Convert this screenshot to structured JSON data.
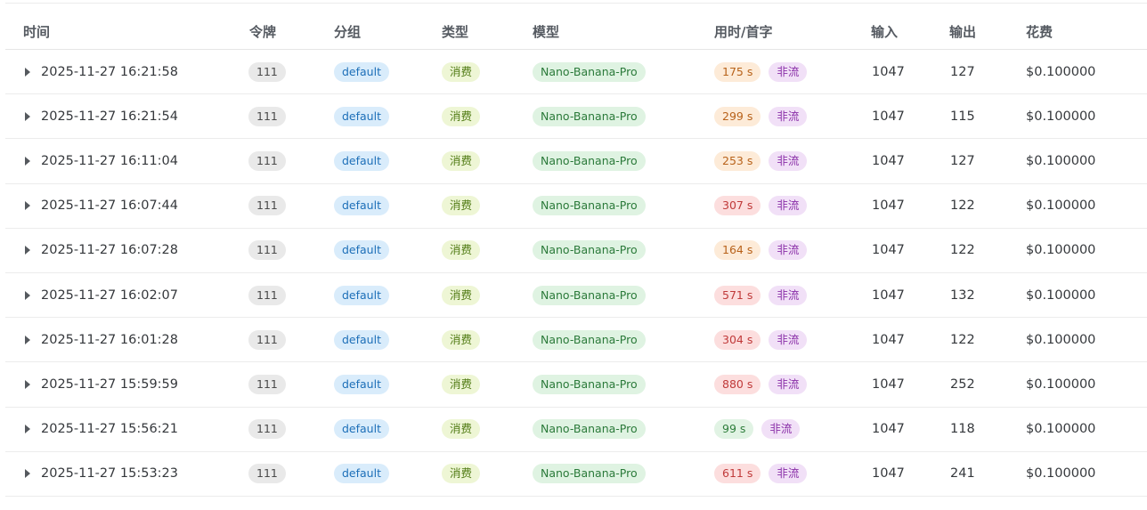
{
  "columns": {
    "time": "时间",
    "token": "令牌",
    "group": "分组",
    "type": "类型",
    "model": "模型",
    "duration": "用时/首字",
    "input": "输入",
    "output": "输出",
    "cost": "花费"
  },
  "colors": {
    "duration_orange": "#fdebd8",
    "duration_red": "#fcdede",
    "duration_green": "#e1f3e4"
  },
  "rows": [
    {
      "time": "2025-11-27 16:21:58",
      "token": "111",
      "group": "default",
      "type": "消费",
      "model": "Nano-Banana-Pro",
      "duration": "175 s",
      "duration_level": "orange",
      "stream": "非流",
      "input": "1047",
      "output": "127",
      "cost": "$0.100000"
    },
    {
      "time": "2025-11-27 16:21:54",
      "token": "111",
      "group": "default",
      "type": "消费",
      "model": "Nano-Banana-Pro",
      "duration": "299 s",
      "duration_level": "orange",
      "stream": "非流",
      "input": "1047",
      "output": "115",
      "cost": "$0.100000"
    },
    {
      "time": "2025-11-27 16:11:04",
      "token": "111",
      "group": "default",
      "type": "消费",
      "model": "Nano-Banana-Pro",
      "duration": "253 s",
      "duration_level": "orange",
      "stream": "非流",
      "input": "1047",
      "output": "127",
      "cost": "$0.100000"
    },
    {
      "time": "2025-11-27 16:07:44",
      "token": "111",
      "group": "default",
      "type": "消费",
      "model": "Nano-Banana-Pro",
      "duration": "307 s",
      "duration_level": "red",
      "stream": "非流",
      "input": "1047",
      "output": "122",
      "cost": "$0.100000"
    },
    {
      "time": "2025-11-27 16:07:28",
      "token": "111",
      "group": "default",
      "type": "消费",
      "model": "Nano-Banana-Pro",
      "duration": "164 s",
      "duration_level": "orange",
      "stream": "非流",
      "input": "1047",
      "output": "122",
      "cost": "$0.100000"
    },
    {
      "time": "2025-11-27 16:02:07",
      "token": "111",
      "group": "default",
      "type": "消费",
      "model": "Nano-Banana-Pro",
      "duration": "571 s",
      "duration_level": "red",
      "stream": "非流",
      "input": "1047",
      "output": "132",
      "cost": "$0.100000"
    },
    {
      "time": "2025-11-27 16:01:28",
      "token": "111",
      "group": "default",
      "type": "消费",
      "model": "Nano-Banana-Pro",
      "duration": "304 s",
      "duration_level": "red",
      "stream": "非流",
      "input": "1047",
      "output": "122",
      "cost": "$0.100000"
    },
    {
      "time": "2025-11-27 15:59:59",
      "token": "111",
      "group": "default",
      "type": "消费",
      "model": "Nano-Banana-Pro",
      "duration": "880 s",
      "duration_level": "red",
      "stream": "非流",
      "input": "1047",
      "output": "252",
      "cost": "$0.100000"
    },
    {
      "time": "2025-11-27 15:56:21",
      "token": "111",
      "group": "default",
      "type": "消费",
      "model": "Nano-Banana-Pro",
      "duration": "99 s",
      "duration_level": "green",
      "stream": "非流",
      "input": "1047",
      "output": "118",
      "cost": "$0.100000"
    },
    {
      "time": "2025-11-27 15:53:23",
      "token": "111",
      "group": "default",
      "type": "消费",
      "model": "Nano-Banana-Pro",
      "duration": "611 s",
      "duration_level": "red",
      "stream": "非流",
      "input": "1047",
      "output": "241",
      "cost": "$0.100000"
    }
  ]
}
